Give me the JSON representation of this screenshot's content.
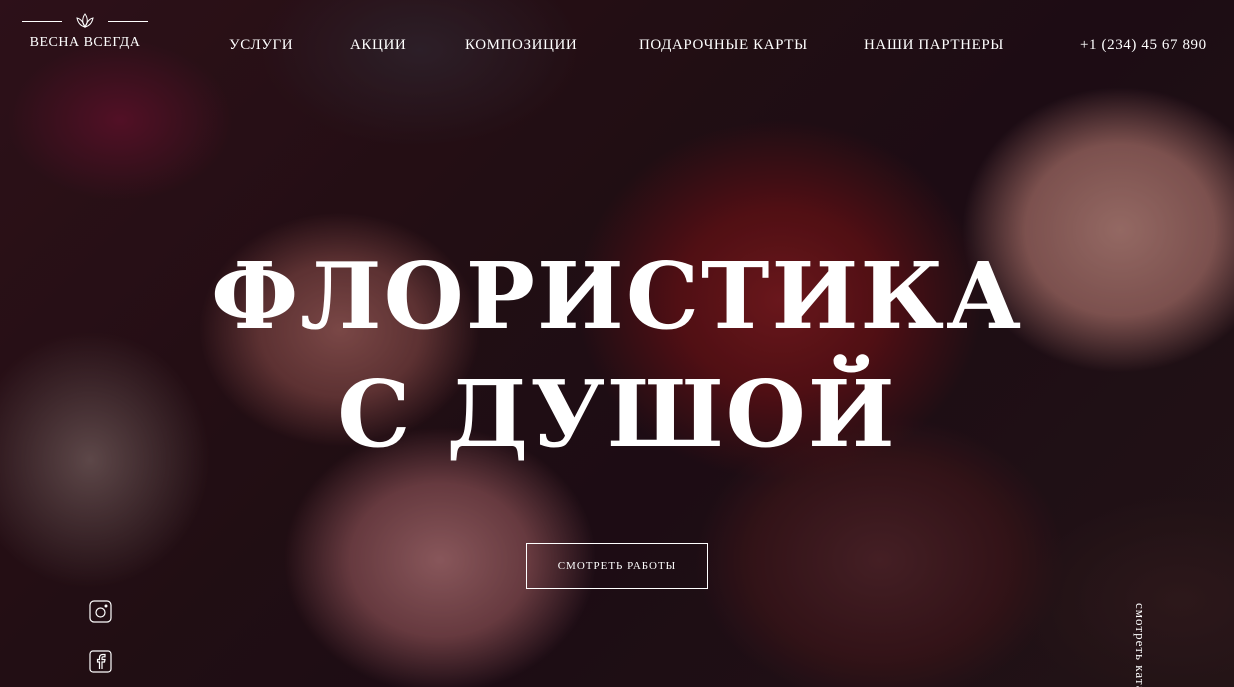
{
  "logo": {
    "text": "ВЕСНА ВСЕГДА",
    "icon": "lotus-icon"
  },
  "nav": {
    "items": [
      {
        "label": "УСЛУГИ"
      },
      {
        "label": "АКЦИИ"
      },
      {
        "label": "КОМПОЗИЦИИ"
      },
      {
        "label": "ПОДАРОЧНЫЕ КАРТЫ"
      },
      {
        "label": "НАШИ ПАРТНЕРЫ"
      }
    ],
    "phone": "+1 (234) 45 67 890"
  },
  "hero": {
    "title_line1": "ФЛОРИСТИКА",
    "title_line2": "С ДУШОЙ",
    "cta_label": "СМОТРЕТЬ РАБОТЫ",
    "scroll_hint": "смотреть каталог"
  },
  "social": [
    {
      "icon": "instagram-icon"
    },
    {
      "icon": "facebook-icon"
    }
  ],
  "colors": {
    "text": "#ffffff",
    "overlay": "#0a0406"
  }
}
